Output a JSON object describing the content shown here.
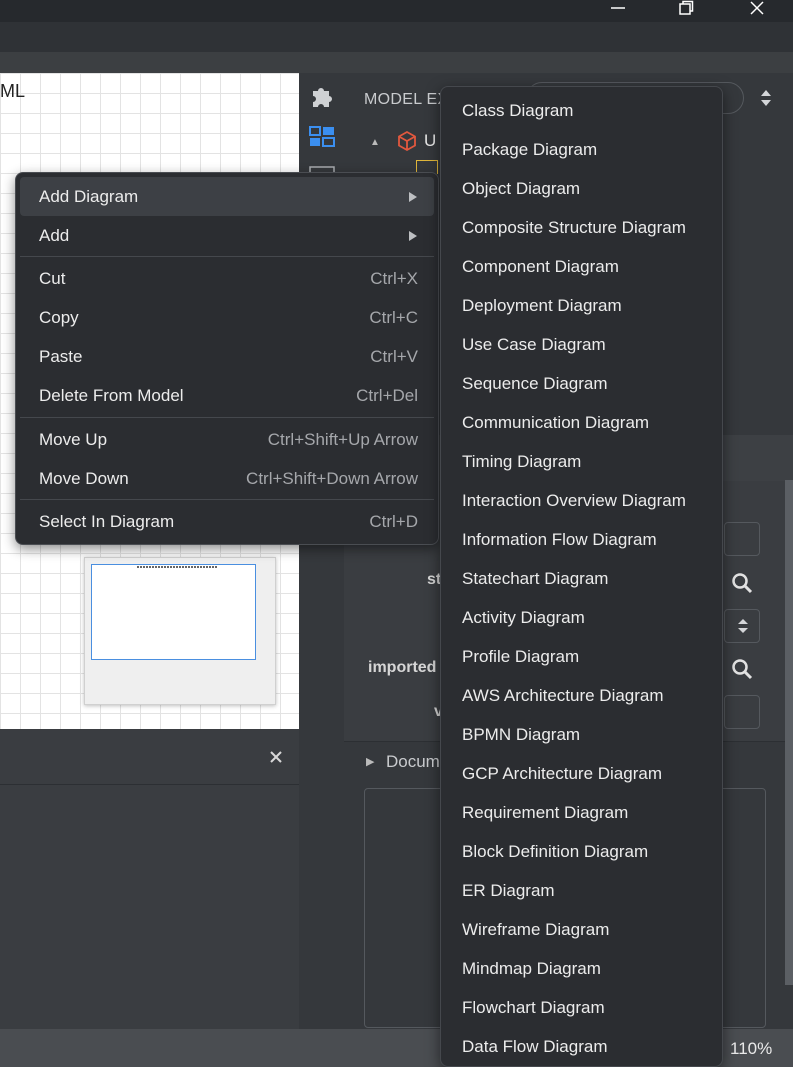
{
  "canvas": {
    "title": "ML"
  },
  "right_panel": {
    "model_explorer_label": "MODEL EX",
    "tree_root_label": "U",
    "props": [
      {
        "label": "st"
      },
      {
        "label": "imported"
      },
      {
        "label": "v"
      }
    ],
    "documentation_label": "Docum"
  },
  "status_bar": {
    "zoom": "110%"
  },
  "context_menu": {
    "items": [
      {
        "label": "Add Diagram",
        "shortcut": "",
        "submenu": true
      },
      {
        "label": "Add",
        "shortcut": "",
        "submenu": true
      },
      {
        "label": "Cut",
        "shortcut": "Ctrl+X"
      },
      {
        "label": "Copy",
        "shortcut": "Ctrl+C"
      },
      {
        "label": "Paste",
        "shortcut": "Ctrl+V"
      },
      {
        "label": "Delete From Model",
        "shortcut": "Ctrl+Del"
      },
      {
        "label": "Move Up",
        "shortcut": "Ctrl+Shift+Up Arrow"
      },
      {
        "label": "Move Down",
        "shortcut": "Ctrl+Shift+Down Arrow"
      },
      {
        "label": "Select In Diagram",
        "shortcut": "Ctrl+D"
      }
    ]
  },
  "submenu": {
    "items": [
      "Class Diagram",
      "Package Diagram",
      "Object Diagram",
      "Composite Structure Diagram",
      "Component Diagram",
      "Deployment Diagram",
      "Use Case Diagram",
      "Sequence Diagram",
      "Communication Diagram",
      "Timing Diagram",
      "Interaction Overview Diagram",
      "Information Flow Diagram",
      "Statechart Diagram",
      "Activity Diagram",
      "Profile Diagram",
      "AWS Architecture Diagram",
      "BPMN Diagram",
      "GCP Architecture Diagram",
      "Requirement Diagram",
      "Block Definition Diagram",
      "ER Diagram",
      "Wireframe Diagram",
      "Mindmap Diagram",
      "Flowchart Diagram",
      "Data Flow Diagram"
    ]
  },
  "icons": {
    "minimize": "minimize-icon",
    "restore": "restore-icon",
    "close": "close-icon",
    "extensions": "puzzle-icon",
    "model_explorer": "grid-icon",
    "search": "search-icon"
  }
}
